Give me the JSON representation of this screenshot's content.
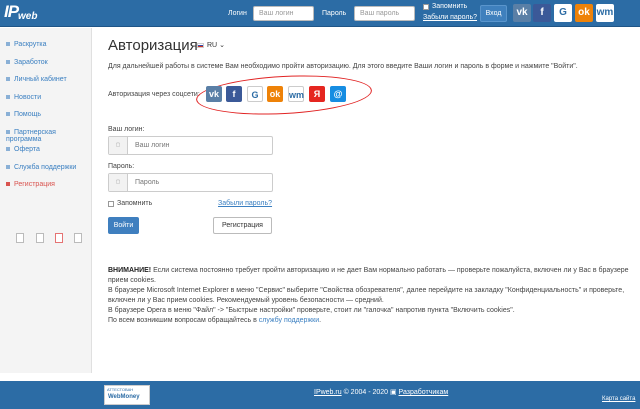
{
  "header": {
    "logo_ip": "IP",
    "logo_web": "web",
    "login_label": "Логин",
    "login_placeholder": "Ваш логин",
    "password_label": "Пароль",
    "password_placeholder": "Ваш пароль",
    "remember": "Запомнить",
    "forgot": "Забыли пароль?",
    "enter_button": "Вход",
    "social": [
      {
        "icon": "vk-icon",
        "glyph": "vk",
        "color": "#5a7fa6"
      },
      {
        "icon": "facebook-icon",
        "glyph": "f",
        "color": "#3b5998"
      },
      {
        "icon": "google-icon",
        "glyph": "G",
        "color": "#ffffff"
      },
      {
        "icon": "odnoklassniki-icon",
        "glyph": "ok",
        "color": "#ee8208"
      },
      {
        "icon": "webmoney-icon",
        "glyph": "wm",
        "color": "#ffffff"
      }
    ]
  },
  "sidebar": {
    "items": [
      {
        "label": "Раскрутка"
      },
      {
        "label": "Заработок"
      },
      {
        "label": "Личный кабинет"
      },
      {
        "label": "Новости"
      },
      {
        "label": "Помощь"
      },
      {
        "label": "Партнерская программа"
      },
      {
        "label": "Оферта"
      },
      {
        "label": "Служба поддержки"
      },
      {
        "label": "Регистрация",
        "active": true
      }
    ]
  },
  "main": {
    "title": "Авторизация",
    "lang": "RU",
    "intro": "Для дальнейшей работы в системе Вам необходимо пройти авторизацию. Для этого введите Ваши логин и пароль в форме и нажмите \"Войти\".",
    "social_label": "Авторизация через соцсети:",
    "social": [
      {
        "icon": "vk-icon",
        "glyph": "vk",
        "color": "#5a7fa6"
      },
      {
        "icon": "facebook-icon",
        "glyph": "f",
        "color": "#3b5998"
      },
      {
        "icon": "google-icon",
        "glyph": "G",
        "color": "#ffffff"
      },
      {
        "icon": "odnoklassniki-icon",
        "glyph": "ok",
        "color": "#ee8208"
      },
      {
        "icon": "webmoney-icon",
        "glyph": "wm",
        "color": "#ffffff"
      },
      {
        "icon": "yandex-icon",
        "glyph": "Я",
        "color": "#e52620"
      },
      {
        "icon": "mailru-icon",
        "glyph": "@",
        "color": "#168de2"
      }
    ],
    "login_label": "Ваш логин:",
    "login_placeholder": "Ваш логин",
    "password_label": "Пароль:",
    "password_placeholder": "Пароль",
    "remember": "Запомнить",
    "forgot": "Забыли пароль?",
    "login_button": "Войти",
    "register_button": "Регистрация",
    "warning": {
      "bold": "ВНИМАНИЕ!",
      "p1": " Если система постоянно требует пройти авторизацию и не дает Вам нормально работать — проверьте пожалуйста, включен ли у Вас в браузере прием cookies.",
      "p2": "В браузере Microsoft Internet Explorer в меню \"Сервис\" выберите \"Свойства обозревателя\", далее перейдите на закладку \"Конфиденциальность\" и проверьте, включен ли у Вас прием cookies. Рекомендуемый уровень безопасности — средний.",
      "p3": "В браузере Opera в меню \"Файл\" -> \"Быстрые настройки\" проверьте, стоит ли \"галочка\" напротив пункта \"Включить cookies\".",
      "p4": "По всем возникшим вопросам обращайтесь в ",
      "p4_link": "службу поддержки",
      "p4_end": "."
    }
  },
  "footer": {
    "badge_top": "АТТЕСТОВАН",
    "badge_name": "WebMoney",
    "site": "IPweb.ru",
    "copyright": " © 2004 - 2020  ",
    "dev_link": "Разработчикам",
    "map": "Карта сайта"
  }
}
